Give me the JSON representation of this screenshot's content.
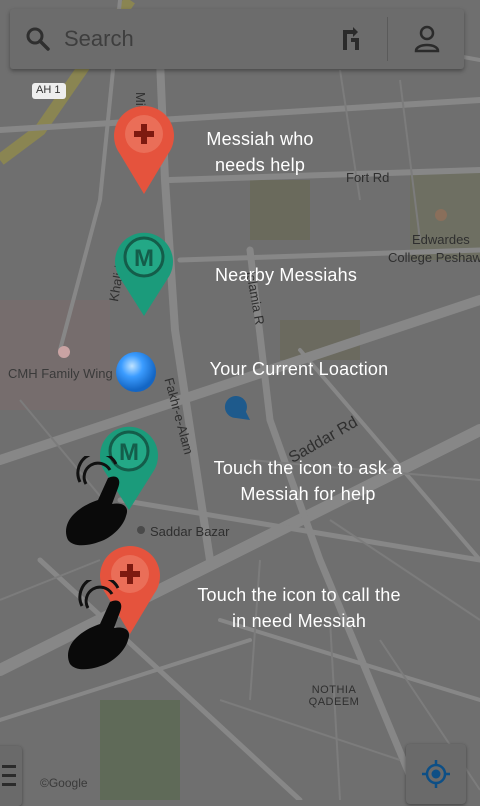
{
  "search": {
    "placeholder": "Search"
  },
  "legend": {
    "help_needed": "Messiah who needs help",
    "nearby": "Nearby Messiahs",
    "current_location": "Your Current Loaction",
    "ask_help": "Touch the icon to ask a Messiah for help",
    "call_in_need": "Touch the icon to call the in need Messiah"
  },
  "map_labels": {
    "ah1": "AH 1",
    "michni": "Michni",
    "fort_rd": "Fort Rd",
    "edwardes": "Edwardes",
    "college_peshawar": "College Peshaw",
    "khalid_ln": "Khalid Ln",
    "islamia_rd": "Islamia R",
    "cmh": "CMH Family Wing",
    "fakhr_alam": "Fakhr-e-Alam",
    "saddar_rd": "Saddar Rd",
    "saddar_bazar": "Saddar Bazar",
    "nothia_qadeem": "NOTHIA QADEEM",
    "copyright": "©Google"
  },
  "colors": {
    "red_pin": "#e5533d",
    "green_pin": "#1b9b7b",
    "overlay": "#6f6f6f"
  },
  "icons": [
    "search-icon",
    "directions-icon",
    "account-icon",
    "plus-icon",
    "messiah-m-icon",
    "hand-pointer-icon",
    "my-location-icon",
    "menu-icon"
  ]
}
